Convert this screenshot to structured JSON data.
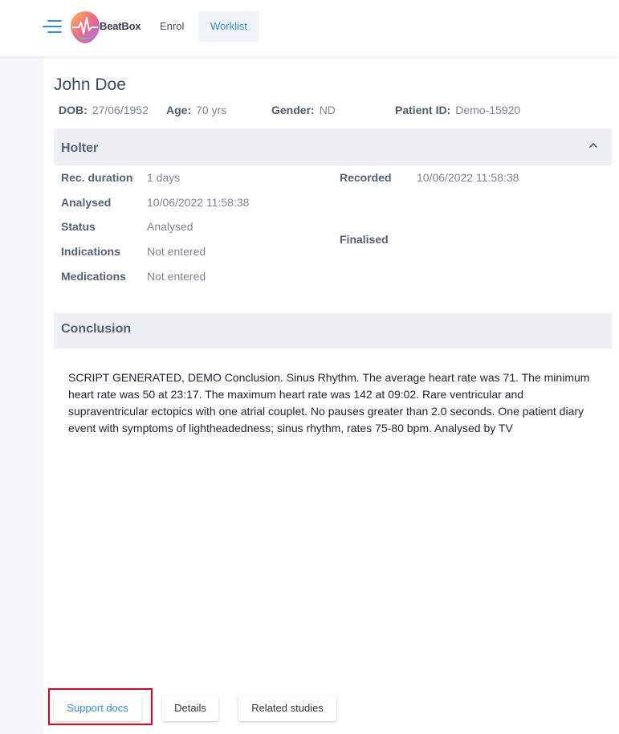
{
  "app": {
    "brand": "BeatBox",
    "nav": {
      "enrol": "Enrol",
      "worklist": "Worklist"
    }
  },
  "patient": {
    "name": "John Doe",
    "dob_label": "DOB:",
    "dob": "27/06/1952",
    "age_label": "Age:",
    "age": "70 yrs",
    "gender_label": "Gender:",
    "gender": "ND",
    "id_label": "Patient ID:",
    "id": "Demo-15920"
  },
  "holter": {
    "title": "Holter",
    "rec_duration_label": "Rec. duration",
    "rec_duration": "1 days",
    "recorded_label": "Recorded",
    "recorded": "10/06/2022 11:58:38",
    "analysed_label": "Analysed",
    "analysed": "10/06/2022 11:58:38",
    "status_label": "Status",
    "status": "Analysed",
    "finalised_label": "Finalised",
    "indications_label": "Indications",
    "indications": "Not entered",
    "medications_label": "Medications",
    "medications": "Not entered"
  },
  "conclusion": {
    "title": "Conclusion",
    "text": "SCRIPT GENERATED, DEMO Conclusion. Sinus Rhythm. The average heart rate was 71. The minimum heart rate was 50 at 23:17. The maximum heart rate was 142 at 09:02. Rare ventricular and supraventricular ectopics with one atrial couplet. No pauses greater than 2.0 seconds. One patient diary event with symptoms of lightheadedness; sinus rhythm, rates 75-80 bpm. Analysed by TV"
  },
  "buttons": {
    "support_docs": "Support docs",
    "details": "Details",
    "related_studies": "Related studies"
  },
  "colors": {
    "accent": "#2f8fdc",
    "highlight": "#e3001b"
  }
}
